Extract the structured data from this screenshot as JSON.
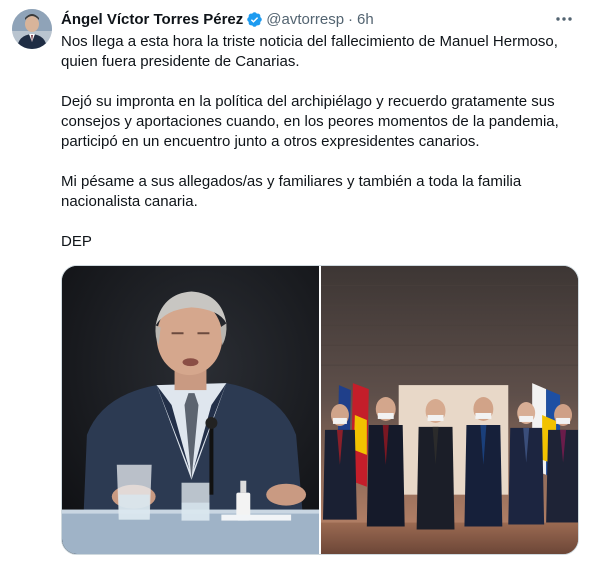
{
  "author": {
    "display_name": "Ángel Víctor Torres Pérez",
    "handle": "@avtorresp",
    "separator": "·",
    "time": "6h",
    "verified_icon": "verified-badge-icon",
    "avatar_icon": "profile-photo"
  },
  "menu": {
    "more_icon": "more-horizontal-icon",
    "glyph": "•••"
  },
  "tweet": {
    "paragraphs": [
      "Nos llega a esta hora la triste noticia del fallecimiento de Manuel Hermoso, quien fuera presidente de Canarias.",
      "Dejó su impronta en la política del archipiélago y recuerdo gratamente sus consejos y aportaciones cuando, en los peores momentos de la pandemia, participó en un encuentro junto a otros expresidentes canarios.",
      "Mi pésame a sus allegados/as y familiares y también a toda la familia nacionalista canaria.",
      "DEP"
    ]
  },
  "media": {
    "images": [
      {
        "name": "photo-elderly-man-speaking"
      },
      {
        "name": "photo-group-of-former-presidents"
      }
    ]
  },
  "colors": {
    "text": "#0f1419",
    "secondary": "#536471",
    "verified": "#1d9bf0",
    "border": "#cfd9de"
  }
}
